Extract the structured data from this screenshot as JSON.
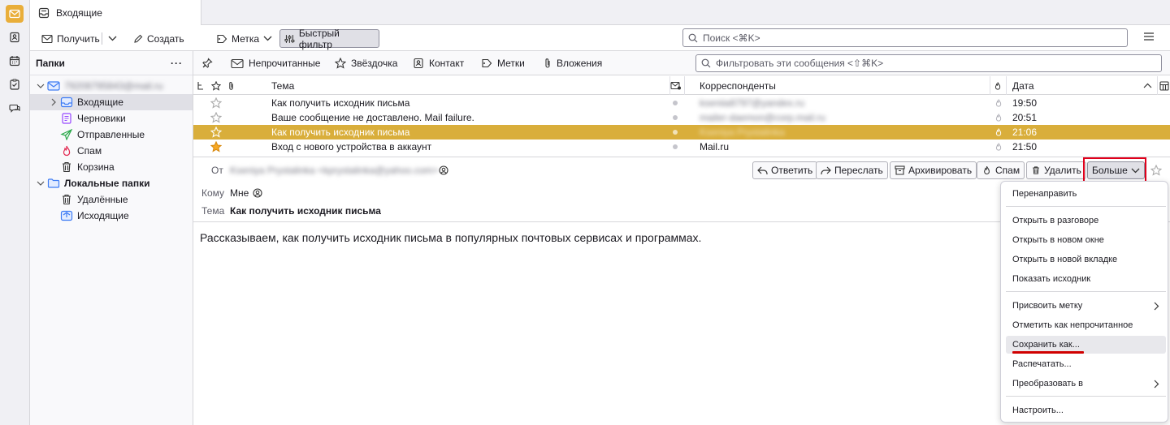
{
  "spaces": [
    "mail-icon",
    "address-book-icon",
    "calendar-icon",
    "tasks-icon",
    "chat-icon"
  ],
  "tab": {
    "title": "Входящие"
  },
  "toolbar": {
    "get": "Получить",
    "write": "Создать",
    "tag": "Метка",
    "quick_filter": "Быстрый фильтр",
    "search_placeholder": "Поиск <⌘K>"
  },
  "folders": {
    "header": "Папки",
    "more": "···",
    "account": "79208795843@mail.ru",
    "items": [
      {
        "label": "Входящие",
        "selected": true
      },
      {
        "label": "Черновики"
      },
      {
        "label": "Отправленные"
      },
      {
        "label": "Спам"
      },
      {
        "label": "Корзина"
      }
    ],
    "local": "Локальные папки",
    "local_items": [
      {
        "label": "Удалённые"
      },
      {
        "label": "Исходящие"
      }
    ]
  },
  "quickfilter": {
    "unread": "Непрочитанные",
    "starred": "Звёздочка",
    "contact": "Контакт",
    "tags": "Метки",
    "attachments": "Вложения",
    "placeholder": "Фильтровать эти сообщения <⇧⌘K>"
  },
  "columns": {
    "subject": "Тема",
    "correspondents": "Корреспонденты",
    "date": "Дата"
  },
  "messages": [
    {
      "starred": false,
      "subject": "Как получить исходник письма",
      "from": "kseniia8797@yandex.ru",
      "date": "19:50",
      "blurred": true
    },
    {
      "starred": false,
      "subject": "Ваше сообщение не доставлено. Mail failure.",
      "from": "mailer-daemon@corp.mail.ru",
      "date": "20:51",
      "blurred": true
    },
    {
      "starred": false,
      "subject": "Как получить исходник письма",
      "from": "Kseniya Prystalinka",
      "date": "21:06",
      "blurred": true,
      "selected": true
    },
    {
      "starred": true,
      "subject": "Вход с нового устройства в аккаунт",
      "from": "Mail.ru",
      "date": "21:50",
      "blurred": false
    }
  ],
  "header": {
    "from_label": "От",
    "from_value": "Kseniya Prystalinka <kprystalinka@yahoo.com>",
    "to_label": "Кому",
    "to_value": "Мне",
    "subject_label": "Тема",
    "subject_value": "Как получить исходник письма",
    "buttons": {
      "reply": "Ответить",
      "forward": "Переслать",
      "archive": "Архивировать",
      "spam": "Спам",
      "delete": "Удалить",
      "more": "Больше"
    }
  },
  "body": "Рассказываем, как получить исходник письма в популярных почтовых сервисах и программах.",
  "menu": {
    "items": [
      "Перенаправить",
      "Открыть в разговоре",
      "Открыть в новом окне",
      "Открыть в новой вкладке",
      "Показать исходник",
      "Присвоить метку",
      "Отметить как непрочитанное",
      "Сохранить как...",
      "Распечатать...",
      "Преобразовать в",
      "Настроить..."
    ],
    "highlighted": "Сохранить как..."
  },
  "colors": {
    "accent": "#d9ae3b",
    "highlight_red": "#e0001b",
    "underline": "#d00000"
  }
}
